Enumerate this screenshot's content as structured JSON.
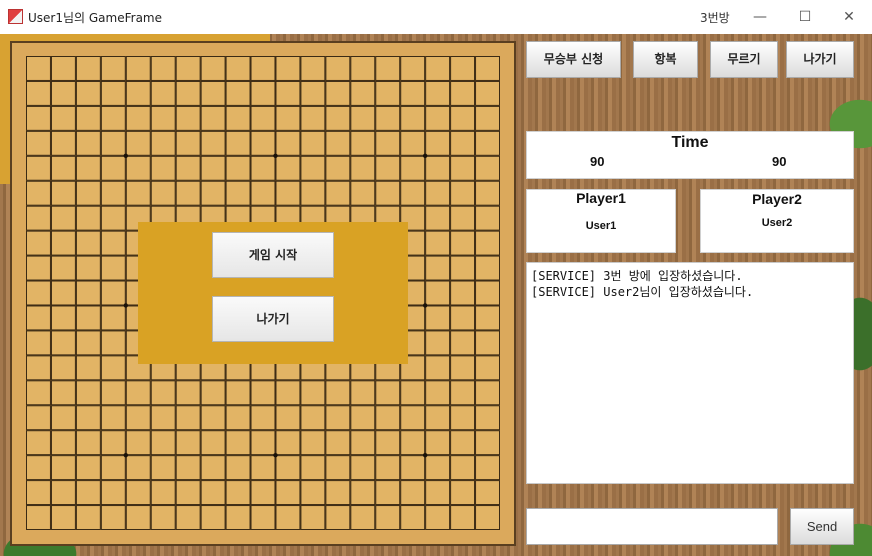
{
  "window": {
    "title": "User1님의 GameFrame",
    "room": "3번방",
    "minimize": "—",
    "maximize": "☐",
    "close": "✕"
  },
  "toolbar": {
    "draw_request": "무승부 신청",
    "surrender": "항복",
    "undo": "무르기",
    "exit": "나가기"
  },
  "timer": {
    "title": "Time",
    "player1_time": "90",
    "player2_time": "90"
  },
  "players": {
    "player1_label": "Player1",
    "player1_name": "User1",
    "player2_label": "Player2",
    "player2_name": "User2"
  },
  "start_panel": {
    "start_game": "게임 시작",
    "exit": "나가기"
  },
  "chat": {
    "messages": [
      "[SERVICE] 3번 방에 입장하셨습니다.",
      "[SERVICE] User2님이 입장하셨습니다."
    ],
    "input_value": "",
    "send": "Send"
  },
  "board": {
    "lines": 19,
    "star_points": [
      [
        3,
        3
      ],
      [
        3,
        9
      ],
      [
        3,
        15
      ],
      [
        9,
        3
      ],
      [
        9,
        9
      ],
      [
        9,
        15
      ],
      [
        15,
        3
      ],
      [
        15,
        9
      ],
      [
        15,
        15
      ]
    ]
  },
  "colors": {
    "board": "#dba95c",
    "panel": "#d9a224"
  }
}
